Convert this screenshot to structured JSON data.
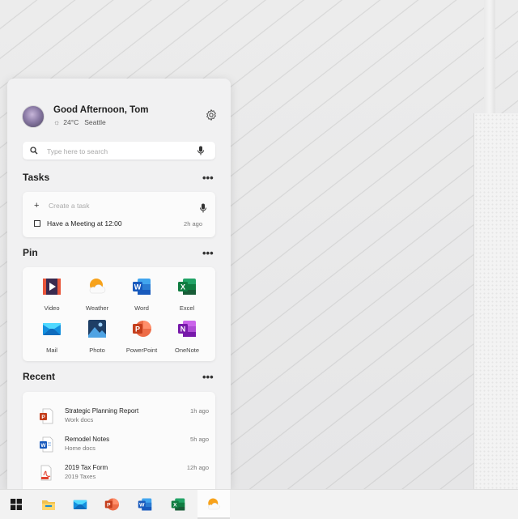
{
  "colors": {
    "accent_word": "#2b579a",
    "accent_excel": "#217346",
    "accent_powerpoint": "#d04423",
    "accent_onenote": "#7719aa",
    "weather_orange": "#f7a21b",
    "mail_blue": "#0f78d4"
  },
  "header": {
    "greeting": "Good Afternoon, Tom",
    "temperature": "24°C",
    "location": "Seattle",
    "icons": [
      "avatar",
      "sun-icon",
      "gear-icon"
    ]
  },
  "search": {
    "placeholder": "Type here to search",
    "value": ""
  },
  "tasks": {
    "title": "Tasks",
    "more_label": "•••",
    "create_placeholder": "Create a task",
    "items": [
      {
        "label": "Have a Meeting at 12:00",
        "time": "2h ago"
      }
    ]
  },
  "pin": {
    "title": "Pin",
    "more_label": "•••",
    "apps": [
      {
        "label": "Video",
        "icon": "video-icon"
      },
      {
        "label": "Weather",
        "icon": "weather-icon"
      },
      {
        "label": "Word",
        "icon": "word-icon"
      },
      {
        "label": "Excel",
        "icon": "excel-icon"
      },
      {
        "label": "Mail",
        "icon": "mail-icon"
      },
      {
        "label": "Photo",
        "icon": "photo-icon"
      },
      {
        "label": "PowerPoint",
        "icon": "powerpoint-icon"
      },
      {
        "label": "OneNote",
        "icon": "onenote-icon"
      }
    ]
  },
  "recent": {
    "title": "Recent",
    "more_label": "•••",
    "items": [
      {
        "name": "Strategic Planning Report",
        "location": "Work docs",
        "time": "1h ago",
        "icon": "powerpoint-file-icon"
      },
      {
        "name": "Remodel Notes",
        "location": "Home docs",
        "time": "5h ago",
        "icon": "word-file-icon"
      },
      {
        "name": "2019 Tax Form",
        "location": "2019 Taxes",
        "time": "12h ago",
        "icon": "pdf-file-icon"
      }
    ]
  },
  "taskbar": {
    "items": [
      {
        "icon": "windows-start-icon"
      },
      {
        "icon": "file-explorer-icon"
      },
      {
        "icon": "mail-icon"
      },
      {
        "icon": "powerpoint-icon"
      },
      {
        "icon": "word-icon"
      },
      {
        "icon": "excel-icon"
      },
      {
        "icon": "weather-icon",
        "active": true
      }
    ]
  }
}
